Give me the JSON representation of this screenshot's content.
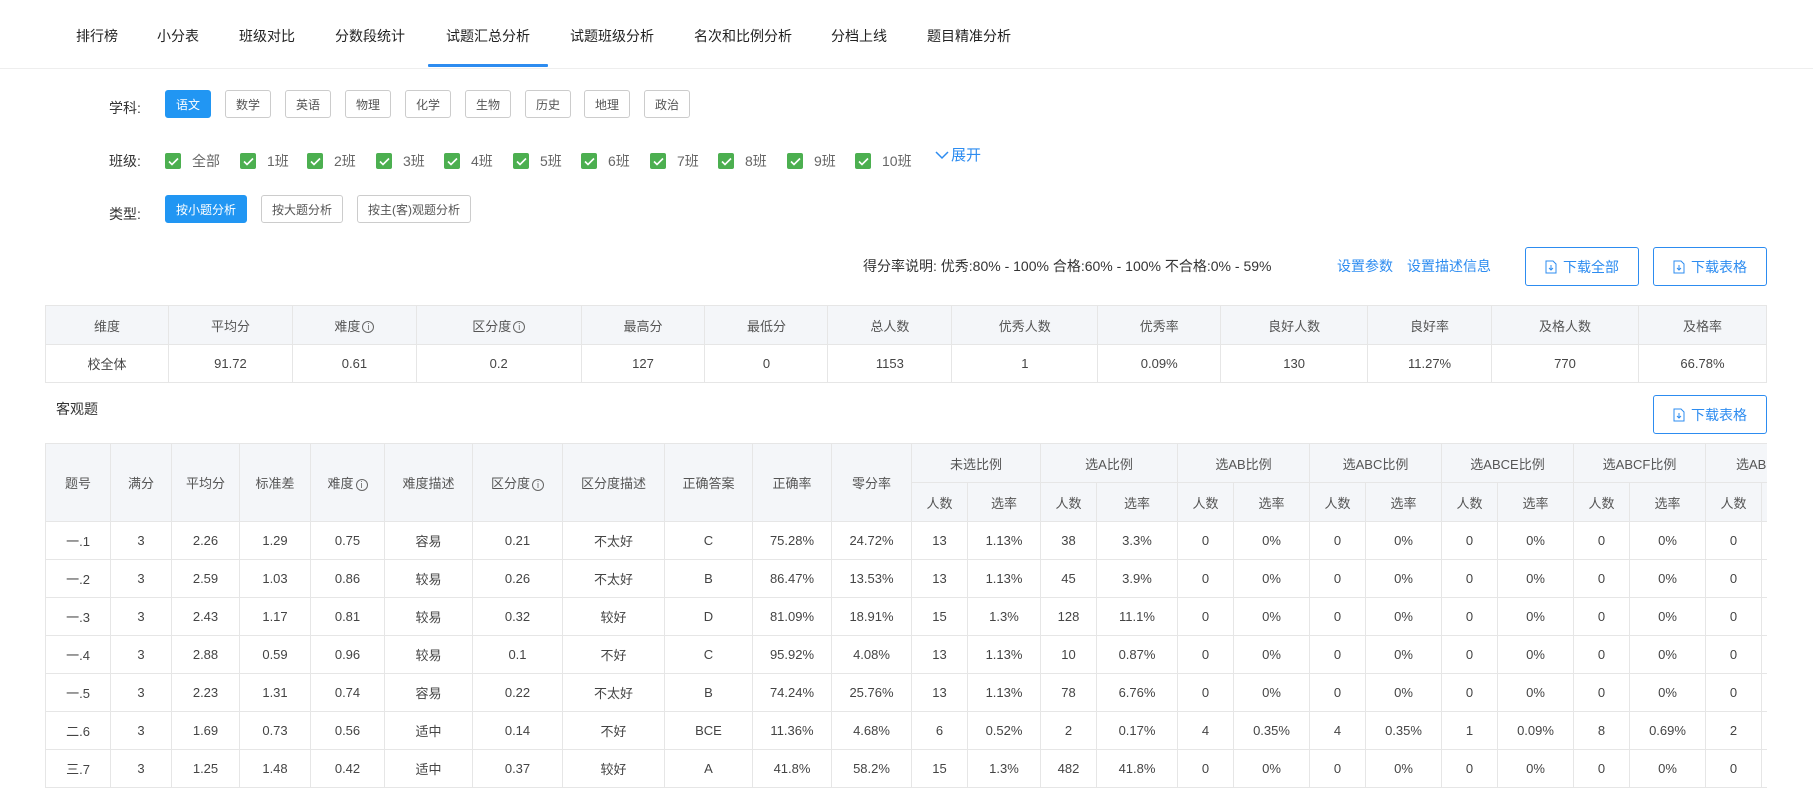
{
  "tabs": [
    "排行榜",
    "小分表",
    "班级对比",
    "分数段统计",
    "试题汇总分析",
    "试题班级分析",
    "名次和比例分析",
    "分档上线",
    "题目精准分析"
  ],
  "active_tab": 4,
  "filters": {
    "subject_label": "学科:",
    "subjects": [
      "语文",
      "数学",
      "英语",
      "物理",
      "化学",
      "生物",
      "历史",
      "地理",
      "政治"
    ],
    "class_label": "班级:",
    "classes": [
      "全部",
      "1班",
      "2班",
      "3班",
      "4班",
      "5班",
      "6班",
      "7班",
      "8班",
      "9班",
      "10班"
    ],
    "expand_label": "展开",
    "type_label": "类型:",
    "types": [
      "按小题分析",
      "按大题分析",
      "按主(客)观题分析"
    ]
  },
  "legend_text": "得分率说明:  优秀:80% - 100% 合格:60% - 100% 不合格:0% - 59%",
  "links": {
    "set_params": "设置参数",
    "set_desc": "设置描述信息"
  },
  "buttons": {
    "download_all": "下载全部",
    "download_table": "下载表格",
    "download_table2": "下载表格"
  },
  "summary": {
    "headers": [
      "维度",
      "平均分",
      "难度",
      "区分度",
      "最高分",
      "最低分",
      "总人数",
      "优秀人数",
      "优秀率",
      "良好人数",
      "良好率",
      "及格人数",
      "及格率"
    ],
    "row": [
      "校全体",
      "91.72",
      "0.61",
      "0.2",
      "127",
      "0",
      "1153",
      "1",
      "0.09%",
      "130",
      "11.27%",
      "770",
      "66.78%"
    ]
  },
  "section_title": "客观题",
  "objective": {
    "fixed_headers": [
      "题号",
      "满分",
      "平均分",
      "标准差",
      "难度",
      "难度描述",
      "区分度",
      "区分度描述",
      "正确答案",
      "正确率",
      "零分率"
    ],
    "group_headers": [
      "未选比例",
      "选A比例",
      "选AB比例",
      "选ABC比例",
      "选ABCE比例",
      "选ABCF比例",
      "选ABD"
    ],
    "sub_headers": [
      "人数",
      "选率"
    ],
    "rows": [
      [
        "一.1",
        "3",
        "2.26",
        "1.29",
        "0.75",
        "容易",
        "0.21",
        "不太好",
        "C",
        "75.28%",
        "24.72%",
        "13",
        "1.13%",
        "38",
        "3.3%",
        "0",
        "0%",
        "0",
        "0%",
        "0",
        "0%",
        "0",
        "0%",
        "0"
      ],
      [
        "一.2",
        "3",
        "2.59",
        "1.03",
        "0.86",
        "较易",
        "0.26",
        "不太好",
        "B",
        "86.47%",
        "13.53%",
        "13",
        "1.13%",
        "45",
        "3.9%",
        "0",
        "0%",
        "0",
        "0%",
        "0",
        "0%",
        "0",
        "0%",
        "0"
      ],
      [
        "一.3",
        "3",
        "2.43",
        "1.17",
        "0.81",
        "较易",
        "0.32",
        "较好",
        "D",
        "81.09%",
        "18.91%",
        "15",
        "1.3%",
        "128",
        "11.1%",
        "0",
        "0%",
        "0",
        "0%",
        "0",
        "0%",
        "0",
        "0%",
        "0"
      ],
      [
        "一.4",
        "3",
        "2.88",
        "0.59",
        "0.96",
        "较易",
        "0.1",
        "不好",
        "C",
        "95.92%",
        "4.08%",
        "13",
        "1.13%",
        "10",
        "0.87%",
        "0",
        "0%",
        "0",
        "0%",
        "0",
        "0%",
        "0",
        "0%",
        "0"
      ],
      [
        "一.5",
        "3",
        "2.23",
        "1.31",
        "0.74",
        "容易",
        "0.22",
        "不太好",
        "B",
        "74.24%",
        "25.76%",
        "13",
        "1.13%",
        "78",
        "6.76%",
        "0",
        "0%",
        "0",
        "0%",
        "0",
        "0%",
        "0",
        "0%",
        "0"
      ],
      [
        "二.6",
        "3",
        "1.69",
        "0.73",
        "0.56",
        "适中",
        "0.14",
        "不好",
        "BCE",
        "11.36%",
        "4.68%",
        "6",
        "0.52%",
        "2",
        "0.17%",
        "4",
        "0.35%",
        "4",
        "0.35%",
        "1",
        "0.09%",
        "8",
        "0.69%",
        "2"
      ],
      [
        "三.7",
        "3",
        "1.25",
        "1.48",
        "0.42",
        "适中",
        "0.37",
        "较好",
        "A",
        "41.8%",
        "58.2%",
        "15",
        "1.3%",
        "482",
        "41.8%",
        "0",
        "0%",
        "0",
        "0%",
        "0",
        "0%",
        "0",
        "0%",
        "0"
      ]
    ]
  }
}
